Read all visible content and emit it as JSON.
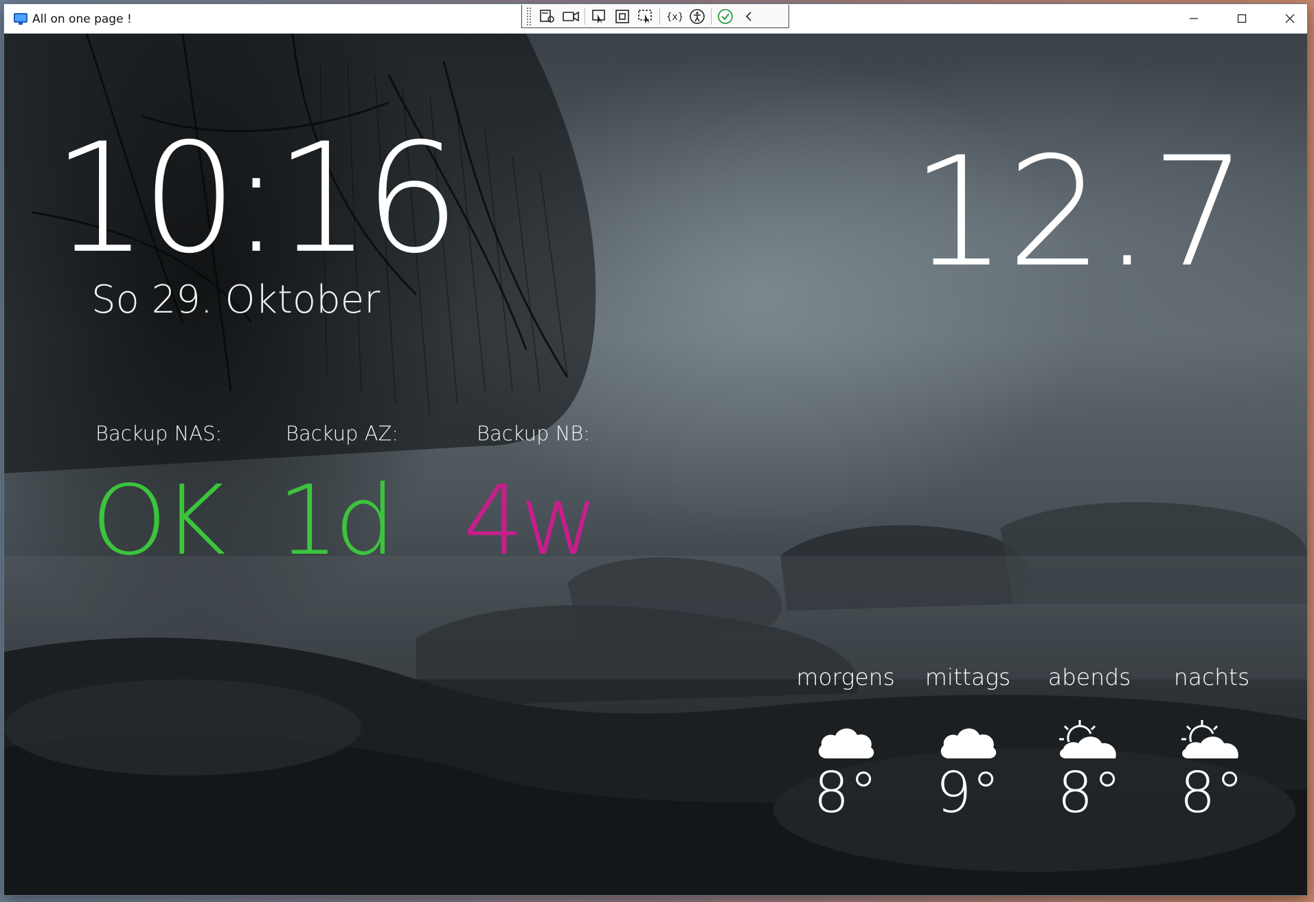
{
  "window": {
    "title": "All on one page !",
    "controls": {
      "minimize": "minimize",
      "maximize": "maximize",
      "close": "close"
    }
  },
  "debug_toolbar": {
    "buttons": [
      "live-visual-tree-icon",
      "record-icon",
      "select-element-icon",
      "display-layout-adorners-icon",
      "track-focused-element-icon",
      "binding-failures-icon",
      "accessibility-icon",
      "hot-reload-ok-icon",
      "collapse-chevron-icon"
    ],
    "accent_ok": "#2ea043"
  },
  "clock": {
    "time": "10:16",
    "date": "So 29. Oktober"
  },
  "weather": {
    "current_temperature": "12.7 °"
  },
  "backups": [
    {
      "label": "Backup NAS:",
      "value": "OK",
      "color": "#3cc43c"
    },
    {
      "label": "Backup AZ:",
      "value": "1d",
      "color": "#3cc43c"
    },
    {
      "label": "Backup NB:",
      "value": "4w",
      "color": "#c81e8c"
    }
  ],
  "forecast": [
    {
      "label": "morgens",
      "icon": "cloud-icon",
      "temp": "8°"
    },
    {
      "label": "mittags",
      "icon": "cloud-icon",
      "temp": "9°"
    },
    {
      "label": "abends",
      "icon": "partly-cloudy-icon",
      "temp": "8°"
    },
    {
      "label": "nachts",
      "icon": "partly-cloudy-icon",
      "temp": "8°"
    }
  ]
}
